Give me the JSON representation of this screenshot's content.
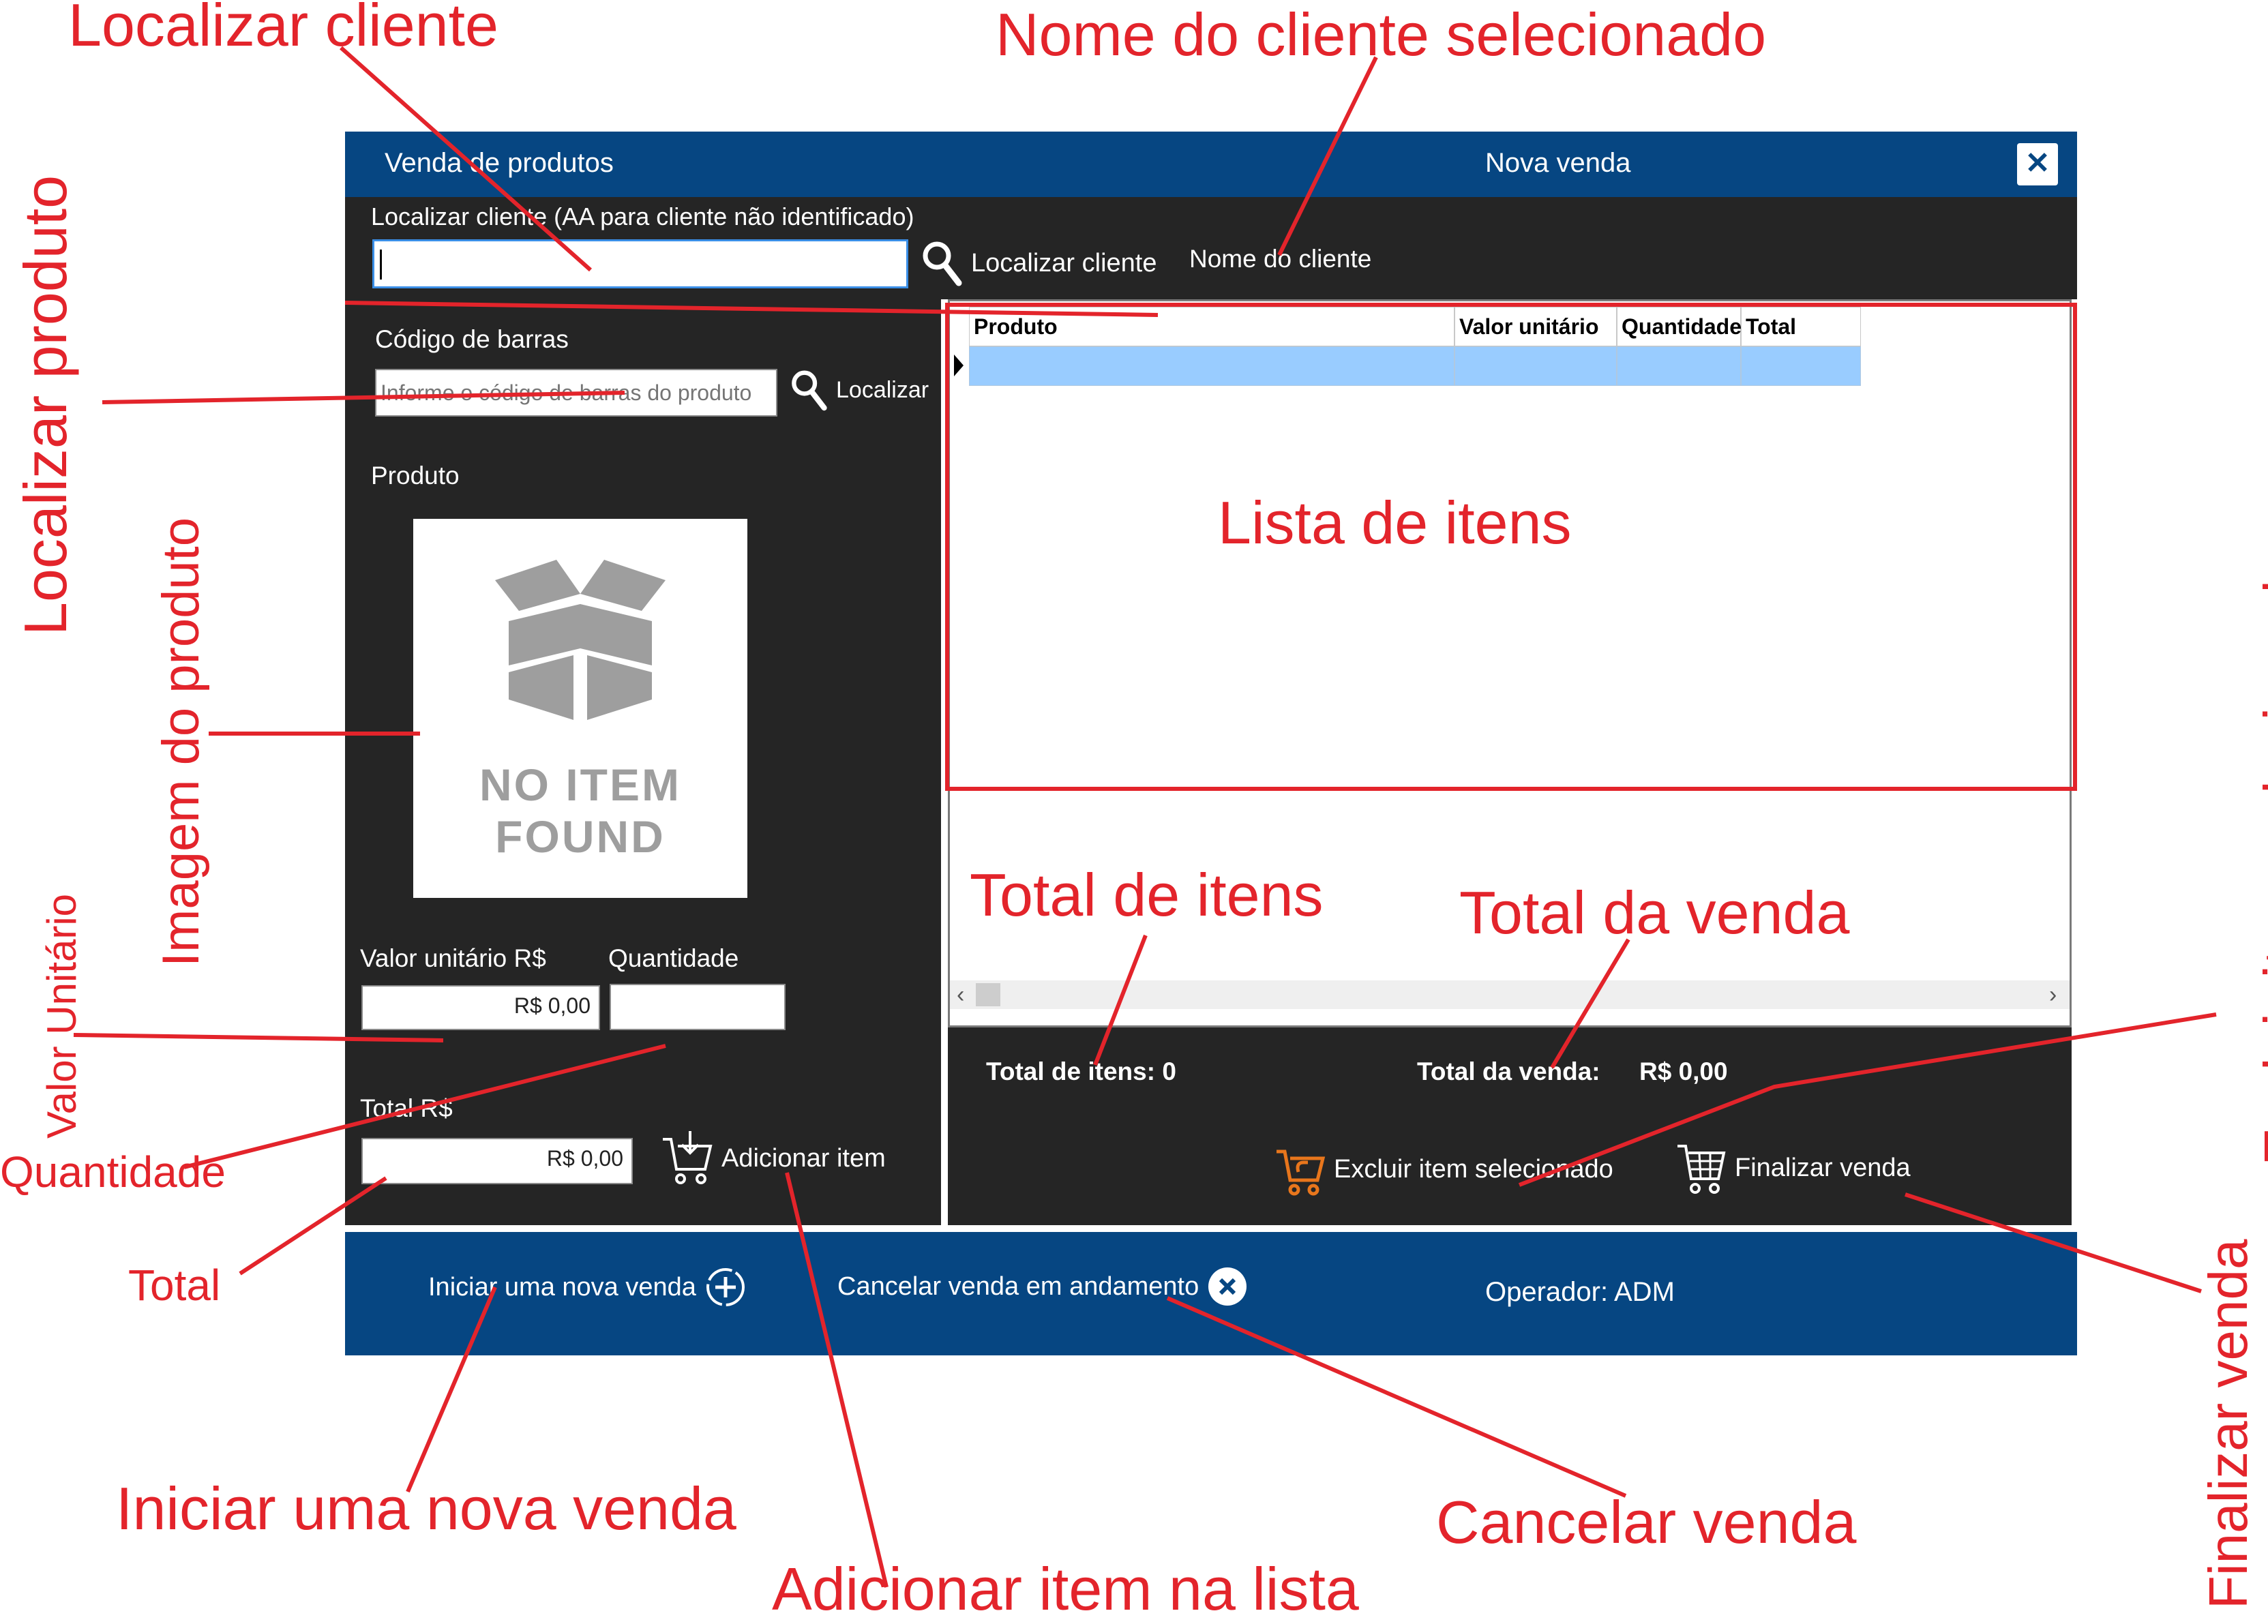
{
  "window": {
    "app_title": "Venda de produtos",
    "form_title": "Nova venda",
    "close_icon": "close-icon"
  },
  "client": {
    "label": "Localizar cliente (AA para cliente não identificado)",
    "value": "",
    "search_button": "Localizar cliente",
    "name_label": "Nome do cliente"
  },
  "product": {
    "barcode_label": "Código de barras",
    "barcode_placeholder": "Informe o código de barras do produto",
    "search_button": "Localizar",
    "product_label": "Produto",
    "image_text_1": "NO ITEM",
    "image_text_2": "FOUND",
    "unit_price_label": "Valor unitário R$",
    "unit_price_value": "R$ 0,00",
    "quantity_label": "Quantidade",
    "quantity_value": "",
    "total_label": "Total R$",
    "total_value": "R$ 0,00",
    "add_button": "Adicionar item"
  },
  "grid": {
    "columns": [
      "Produto",
      "Valor unitário",
      "Quantidade",
      "Total"
    ],
    "rows": [
      [
        "",
        "",
        "",
        ""
      ]
    ]
  },
  "totals": {
    "items_label": "Total de itens: 0",
    "sale_label": "Total da venda:",
    "sale_value": "R$ 0,00",
    "delete_button": "Excluir item selecionado",
    "finish_button": "Finalizar venda"
  },
  "footer": {
    "new_sale": "Iniciar uma nova venda",
    "cancel_sale": "Cancelar venda em andamento",
    "operator": "Operador: ADM"
  },
  "annotations": {
    "localizar_cliente": "Localizar cliente",
    "nome_cliente": "Nome do cliente selecionado",
    "localizar_produto": "Localizar produto",
    "imagem_produto": "Imagem do produto",
    "valor_unitario": "Valor Unitário",
    "quantidade": "Quantidade",
    "total": "Total",
    "lista_itens": "Lista de itens",
    "total_itens": "Total de itens",
    "total_venda": "Total da venda",
    "excluir_item": "Excluir item selecionado",
    "finalizar_venda": "Finalizar venda",
    "iniciar_venda": "Iniciar uma nova venda",
    "adicionar_item": "Adicionar item na lista",
    "cancelar_venda": "Cancelar venda"
  },
  "colors": {
    "titlebar": "#064682",
    "panel": "#252525",
    "row_selected": "#99ccff",
    "annotation": "#e3242b"
  }
}
